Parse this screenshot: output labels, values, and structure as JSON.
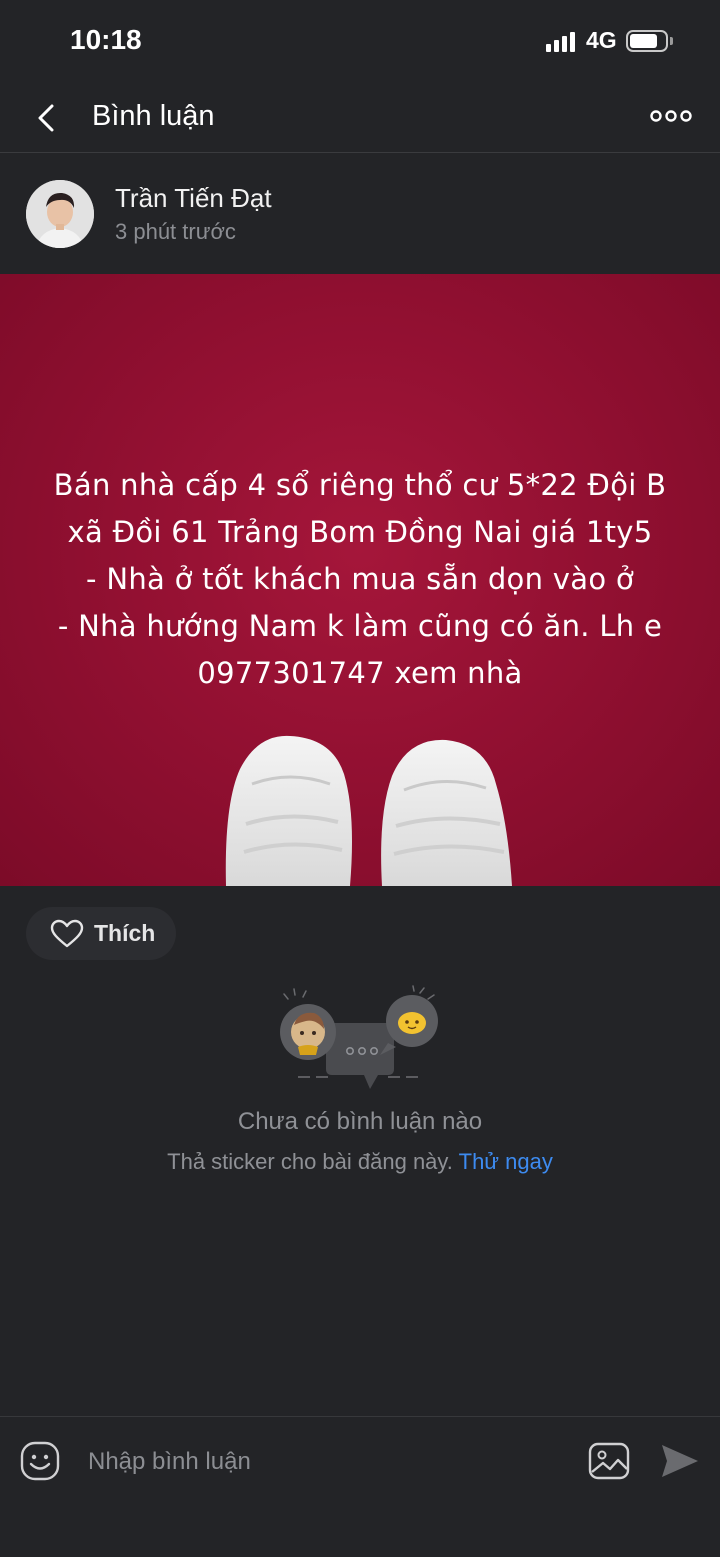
{
  "status_bar": {
    "time": "10:18",
    "network": "4G"
  },
  "header": {
    "title": "Bình luận",
    "back_icon": "chevron-left-icon",
    "more_icon": "more-horizontal-icon"
  },
  "post": {
    "author_name": "Trần Tiến Đạt",
    "time_ago": "3 phút trước",
    "image_text": "Bán nhà cấp 4 sổ riêng thổ cư 5*22 Đội B\nxã Đồi 61 Trảng Bom Đồng Nai giá 1ty5\n- Nhà ở tốt khách mua sẵn dọn vào ở\n- Nhà hướng Nam k làm cũng có ăn. Lh e\n0977301747 xem nhà",
    "background_color": "#960f33"
  },
  "actions": {
    "like_label": "Thích"
  },
  "empty_state": {
    "title": "Chưa có bình luận nào",
    "subtitle": "Thả sticker cho bài đăng này.",
    "link": "Thử ngay"
  },
  "comment_bar": {
    "placeholder": "Nhập bình luận"
  },
  "colors": {
    "background": "#232427",
    "accent_link": "#3d8bf0",
    "muted_text": "#8c8e93"
  }
}
